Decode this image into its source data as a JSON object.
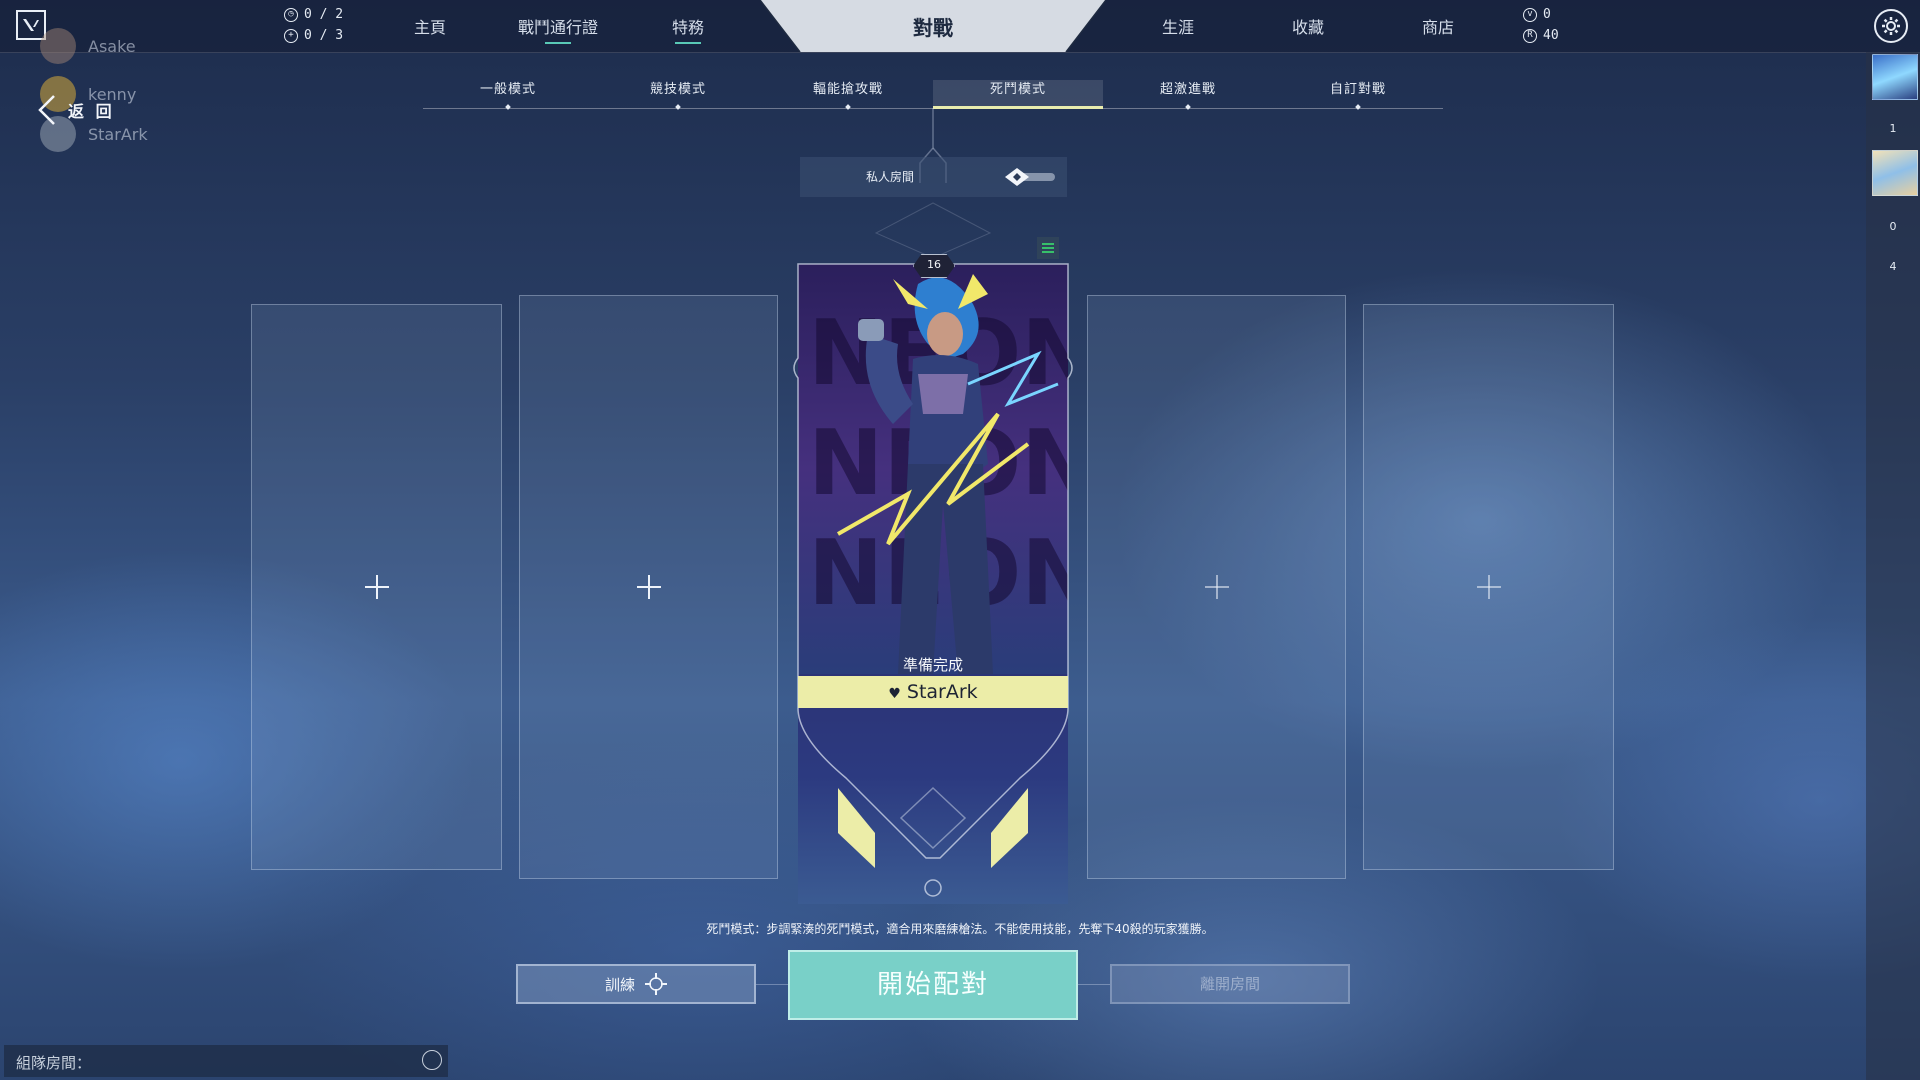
{
  "topbar": {
    "counters": [
      {
        "icon": "clock-icon",
        "value": "0 / 2"
      },
      {
        "icon": "plus-circle-icon",
        "value": "0 / 3"
      }
    ],
    "nav": {
      "home": "主頁",
      "battlepass": "戰鬥通行證",
      "agents": "特務",
      "play": "對戰",
      "career": "生涯",
      "collection": "收藏",
      "store": "商店"
    },
    "currency": {
      "vp": "0",
      "rp": "40"
    }
  },
  "party": {
    "members": [
      "Asake",
      "kenny",
      "StarArk"
    ],
    "back_label": "返 回"
  },
  "modes": [
    "一般模式",
    "競技模式",
    "輻能搶攻戰",
    "死鬥模式",
    "超激進戰",
    "自訂對戰"
  ],
  "active_mode": "死鬥模式",
  "private_room": {
    "label": "私人房間"
  },
  "player_card": {
    "level": "16",
    "status": "準備完成",
    "name": "StarArk"
  },
  "mode_description": "死鬥模式：步調緊湊的死鬥模式，適合用來磨練槍法。不能使用技能，先奪下40殺的玩家獲勝。",
  "buttons": {
    "training": "訓練",
    "start": "開始配對",
    "leave": "離開房間"
  },
  "chat": {
    "label": "組隊房間："
  },
  "right_rail": {
    "counts": [
      "1",
      "0",
      "4"
    ]
  },
  "colors": {
    "accent_teal": "#79d0c8",
    "name_bar": "#eceda8",
    "nav_underline": "#59c9b6"
  }
}
